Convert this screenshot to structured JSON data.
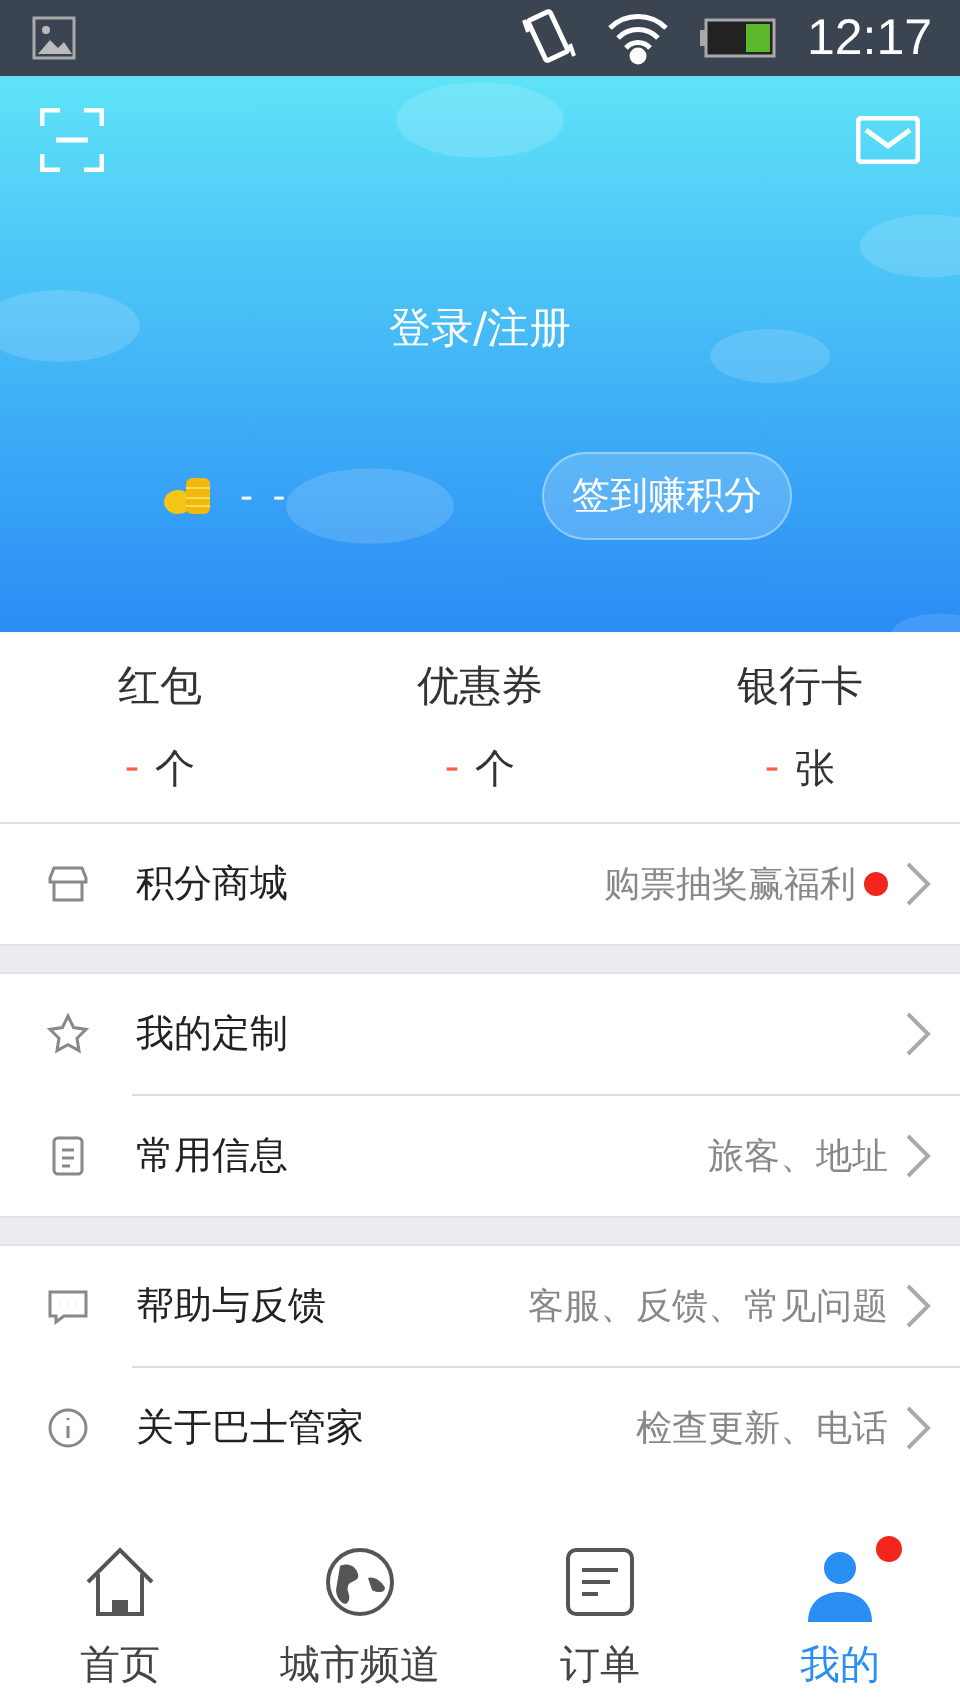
{
  "status_bar": {
    "time": "12:17"
  },
  "header": {
    "login": "登录/注册",
    "points": "- -",
    "checkin_button": "签到赚积分"
  },
  "stats": [
    {
      "label": "红包",
      "value": "-",
      "unit": "个"
    },
    {
      "label": "优惠券",
      "value": "-",
      "unit": "个"
    },
    {
      "label": "银行卡",
      "value": "-",
      "unit": "张"
    }
  ],
  "sections": [
    {
      "items": [
        {
          "kind": "store",
          "label": "积分商城",
          "detail": "购票抽奖赢福利",
          "badge": true
        }
      ]
    },
    {
      "items": [
        {
          "kind": "star",
          "label": "我的定制",
          "badge": false
        },
        {
          "kind": "document",
          "label": "常用信息",
          "detail": "旅客、地址",
          "badge": false
        }
      ]
    },
    {
      "items": [
        {
          "kind": "chat",
          "label": "帮助与反馈",
          "detail": "客服、反馈、常见问题",
          "badge": false
        },
        {
          "kind": "info",
          "label": "关于巴士管家",
          "detail": "检查更新、电话",
          "badge": false
        }
      ]
    }
  ],
  "tab_bar": [
    {
      "kind": "home",
      "label": "首页",
      "selected": false,
      "badge": false
    },
    {
      "kind": "globe",
      "label": "城市频道",
      "selected": false,
      "badge": false
    },
    {
      "kind": "orders",
      "label": "订单",
      "selected": false,
      "badge": false
    },
    {
      "kind": "person",
      "label": "我的",
      "selected": true,
      "badge": true
    }
  ]
}
